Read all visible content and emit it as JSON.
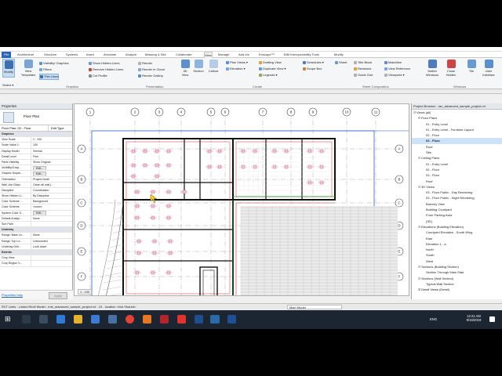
{
  "ribbon": {
    "tabs": [
      "File",
      "Architecture",
      "Structure",
      "Systems",
      "Insert",
      "Annotate",
      "Analyze",
      "Massing & Site",
      "Collaborate",
      "View",
      "Manage",
      "Add-Ins",
      "Enscape™",
      "BIM Interoperability Tools",
      "Modify"
    ],
    "active_tab": "View",
    "modify_label": "Modify",
    "select_label": "Select ▾",
    "graphics_items": [
      "Visibility/ Graphics",
      "Filters",
      "Thin Lines"
    ],
    "view_templates": "View Templates",
    "show_hidden": [
      "Show Hidden Lines",
      "Remove Hidden Lines",
      "Cut Profile"
    ],
    "presentation": [
      "Render",
      "Render in Cloud",
      "Render Gallery"
    ],
    "create_big": [
      "3D View",
      "Section",
      "Callout"
    ],
    "create_small": [
      "Plan Views ▾",
      "Elevation ▾",
      "Drafting View",
      "Duplicate View ▾",
      "Legends ▾",
      "Schedules ▾",
      "Scope Box"
    ],
    "sheet": [
      "Sheet",
      "Title Block",
      "Revisions",
      "Guide Grid",
      "Matchline",
      "View Reference",
      "Viewports ▾"
    ],
    "windows": [
      "Switch Windows",
      "Close Hidden",
      "Tile",
      "User Interface"
    ],
    "panels": [
      "Graphics",
      "Presentation",
      "Create",
      "Sheet Composition",
      "Windows"
    ]
  },
  "properties": {
    "title": "Properties",
    "type_name": "Floor Plan",
    "instance_selector": "Floor Plan: 03 - Floor",
    "edit_type": "Edit Type",
    "rows": [
      {
        "k": "Graphics",
        "v": "",
        "cat": true
      },
      {
        "k": "View Scale",
        "v": "1 : 100"
      },
      {
        "k": "Scale Value 1:",
        "v": "100"
      },
      {
        "k": "Display Model",
        "v": "Normal"
      },
      {
        "k": "Detail Level",
        "v": "Fine"
      },
      {
        "k": "Parts Visibility",
        "v": "Show Original"
      },
      {
        "k": "Visibility/Grap...",
        "v": "Edit..."
      },
      {
        "k": "Graphic Displa...",
        "v": "Edit..."
      },
      {
        "k": "Orientation",
        "v": "Project North"
      },
      {
        "k": "Wall Join Displ...",
        "v": "Clean all wall j..."
      },
      {
        "k": "Discipline",
        "v": "Coordination"
      },
      {
        "k": "Show Hidden Li...",
        "v": "By Discipline"
      },
      {
        "k": "Color Scheme ...",
        "v": "Background"
      },
      {
        "k": "Color Scheme",
        "v": "<none>"
      },
      {
        "k": "System Color S...",
        "v": "Edit..."
      },
      {
        "k": "Default Analys...",
        "v": "None"
      },
      {
        "k": "Sun Path",
        "v": ""
      },
      {
        "k": "Underlay",
        "v": "",
        "cat": true
      },
      {
        "k": "Range: Base Le...",
        "v": "None"
      },
      {
        "k": "Range: Top Le...",
        "v": "Unbounded"
      },
      {
        "k": "Underlay Orie...",
        "v": "Look down"
      },
      {
        "k": "Extents",
        "v": "",
        "cat": true
      },
      {
        "k": "Crop View",
        "v": ""
      },
      {
        "k": "Crop Region V...",
        "v": ""
      }
    ],
    "help_link": "Properties help",
    "apply": "Apply"
  },
  "canvas": {
    "grid_labels": [
      "1",
      "2",
      "3",
      "4",
      "5",
      "6",
      "7",
      "8",
      "9",
      "10",
      "11"
    ],
    "row_labels": [
      "A",
      "B",
      "C",
      "D",
      "E",
      "F"
    ],
    "scale": "1 : 100"
  },
  "browser": {
    "title": "Project Browser - rac_advanced_sample_project.rvt",
    "nodes": [
      {
        "t": "Views (all)",
        "l": 0,
        "g": "⊟"
      },
      {
        "t": "Floor Plans",
        "l": 1,
        "g": "⊟"
      },
      {
        "t": "01 - Entry Level",
        "l": 2
      },
      {
        "t": "01 - Entry Level - Furniture Layout",
        "l": 2
      },
      {
        "t": "02 - Floor",
        "l": 2
      },
      {
        "t": "03 - Floor",
        "l": 2,
        "sel": true
      },
      {
        "t": "Roof",
        "l": 2
      },
      {
        "t": "Site",
        "l": 2
      },
      {
        "t": "Ceiling Plans",
        "l": 1,
        "g": "⊟"
      },
      {
        "t": "01 - Entry Level",
        "l": 2
      },
      {
        "t": "02 - Floor",
        "l": 2
      },
      {
        "t": "03 - Floor",
        "l": 2
      },
      {
        "t": "Roof",
        "l": 2
      },
      {
        "t": "3D Views",
        "l": 1,
        "g": "⊟"
      },
      {
        "t": "03 - Floor Public - Day Rendering",
        "l": 2
      },
      {
        "t": "03 - Floor Public - Night Rendering",
        "l": 2
      },
      {
        "t": "Balcony View",
        "l": 2
      },
      {
        "t": "Building Courtyard",
        "l": 2
      },
      {
        "t": "From Parking Area",
        "l": 2
      },
      {
        "t": "{3D}",
        "l": 2
      },
      {
        "t": "Elevations (Building Elevation)",
        "l": 1,
        "g": "⊟"
      },
      {
        "t": "Courtyard Elevation - South Wing",
        "l": 2
      },
      {
        "t": "East",
        "l": 2
      },
      {
        "t": "Elevation 1 - a",
        "l": 2
      },
      {
        "t": "North",
        "l": 2
      },
      {
        "t": "South",
        "l": 2
      },
      {
        "t": "West",
        "l": 2
      },
      {
        "t": "Sections (Building Section)",
        "l": 1,
        "g": "⊟"
      },
      {
        "t": "Section Through Main Stair",
        "l": 2
      },
      {
        "t": "Sections (Wall Section)",
        "l": 1,
        "g": "⊟"
      },
      {
        "t": "Typical Wall Section",
        "l": 2
      },
      {
        "t": "Detail Views (Detail)",
        "l": 1,
        "g": "⊞"
      }
    ]
  },
  "status": {
    "text": "RVT Links : Linked Revit Model : rme_advanced_sample_project.rvt : 15 - location <Not Shared>",
    "main_model": "Main Model"
  },
  "taskbar": {
    "time": "12:21 AM",
    "date": "9/15/2019",
    "lang": "ENG"
  }
}
